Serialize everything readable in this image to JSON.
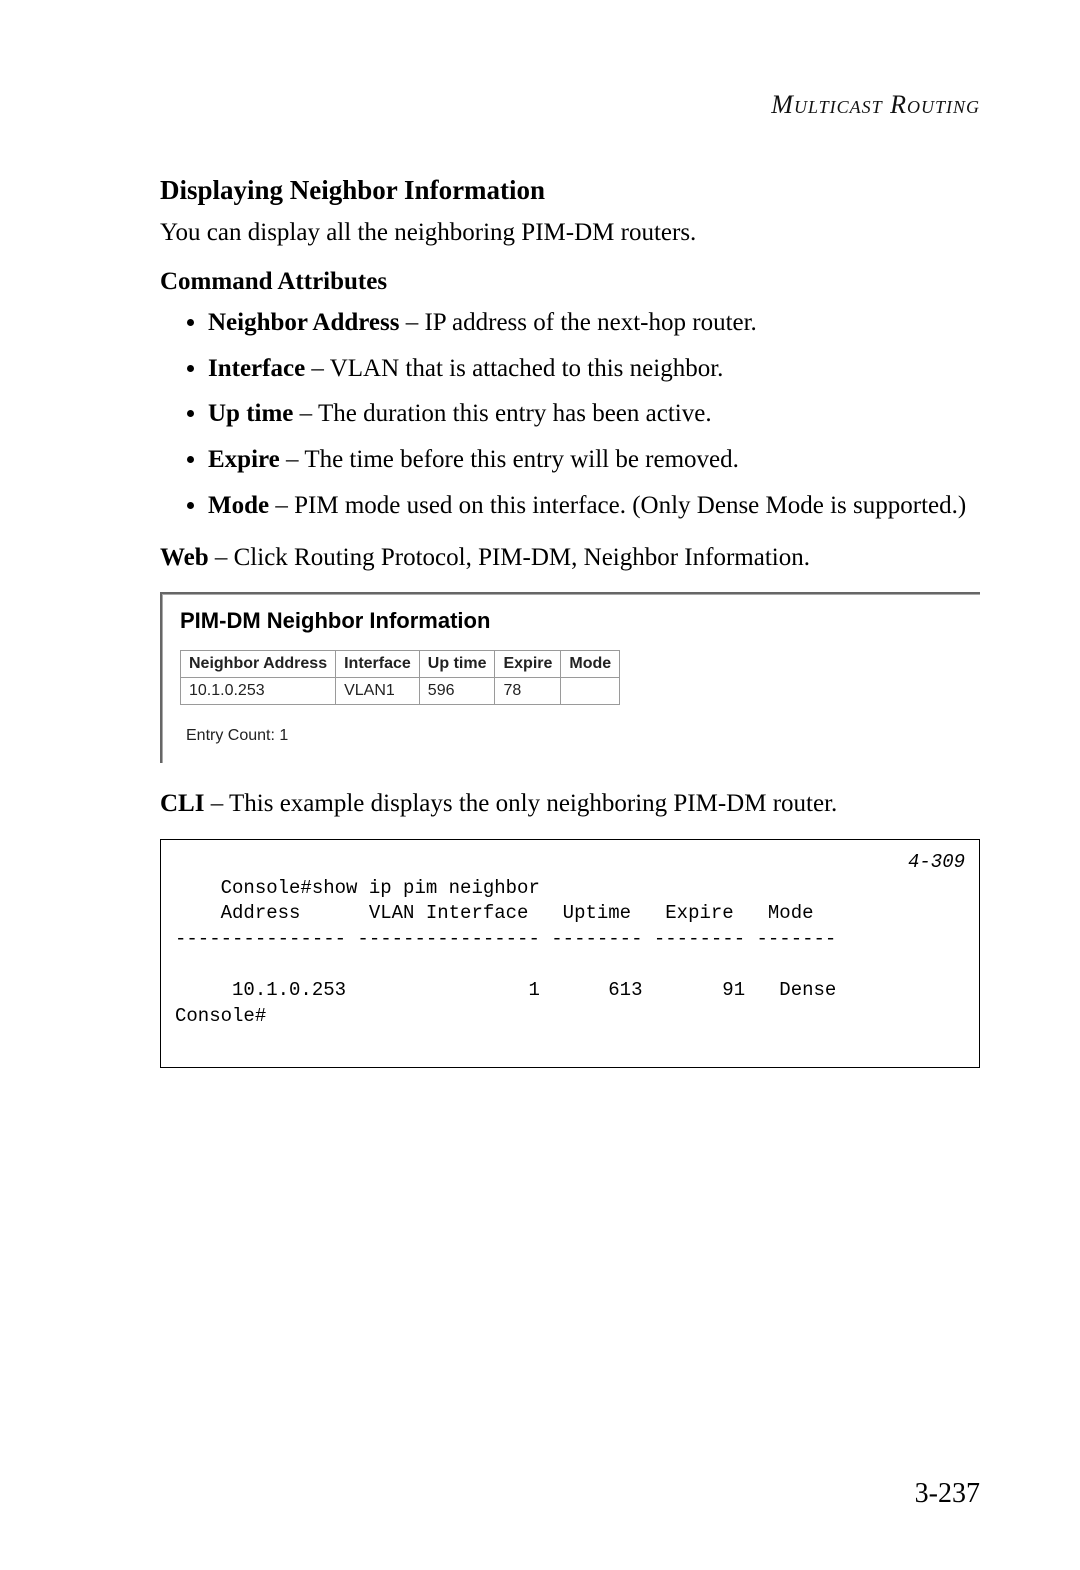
{
  "running_head": "Multicast Routing",
  "section_title": "Displaying Neighbor Information",
  "intro": "You can display all the neighboring PIM-DM routers.",
  "sub_heading": "Command Attributes",
  "attributes": [
    {
      "term": "Neighbor Address",
      "desc": " – IP address of the next-hop router."
    },
    {
      "term": "Interface",
      "desc": " – VLAN that is attached to this neighbor."
    },
    {
      "term": "Up time",
      "desc": " – The duration this entry has been active."
    },
    {
      "term": "Expire",
      "desc": " – The time before this entry will be removed."
    },
    {
      "term": "Mode",
      "desc": " – PIM mode used on this interface. (Only Dense Mode is supported.)"
    }
  ],
  "web_lead": "Web",
  "web_text": " – Click Routing Protocol, PIM-DM, Neighbor Information.",
  "panel": {
    "title": "PIM-DM Neighbor Information",
    "headers": [
      "Neighbor Address",
      "Interface",
      "Up time",
      "Expire",
      "Mode"
    ],
    "row": {
      "addr": "10.1.0.253",
      "iface": "VLAN1",
      "uptime": "596",
      "expire": "78",
      "mode": ""
    },
    "entry_count": "Entry Count: 1"
  },
  "cli_lead": "CLI",
  "cli_text": " – This example displays the only neighboring PIM-DM router.",
  "cli": {
    "ref": "4-309",
    "lines": "Console#show ip pim neighbor\n    Address      VLAN Interface   Uptime   Expire   Mode\n--------------- ---------------- -------- -------- -------\n\n     10.1.0.253                1      613       91   Dense\nConsole#"
  },
  "page_number": "3-237"
}
